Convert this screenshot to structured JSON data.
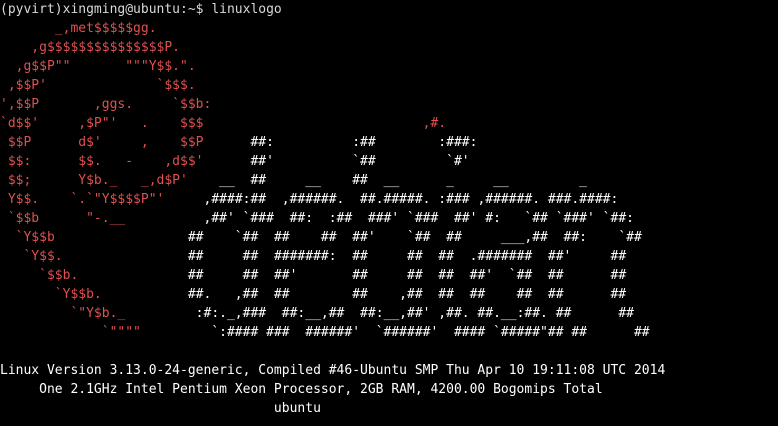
{
  "terminal": {
    "prompt": "(pyvirt)xingming@ubuntu:~$ linuxlogo",
    "logo_lines": [
      {
        "red": "       _,met$$$$$gg.",
        "white": ""
      },
      {
        "red": "    ,g$$$$$$$$$$$$$$$P.",
        "white": ""
      },
      {
        "red": "  ,g$$P\"\"       \"\"\"Y$$.\".",
        "white": ""
      },
      {
        "red": " ,$$P'              `$$$.",
        "white": ""
      },
      {
        "red": "',$$P       ,ggs.     `$$b:",
        "white": ""
      },
      {
        "red": "`d$$'     ,$P\"'   .    $$$",
        "white": "                            ,#."
      },
      {
        "red": " $$P      d$'     ,    $$P",
        "white": "      ##:          :##        :###:"
      },
      {
        "red": " $$:      $$.   -    ,d$$'",
        "white": "      ##'          `##         `#'"
      },
      {
        "red": " $$;      Y$b._   _,d$P'",
        "white": "    __  ##     __    ##  __      _     __         _"
      },
      {
        "red": " Y$$.    `.`\"Y$$$$P\"'",
        "white": "     ,####:##  ,######.  ##.#####. :### ,######. ###.####:"
      },
      {
        "red": " `$$b      \"-.__",
        "white": "          ,##' `###  ##:  :##  ###' `###  ##' #:   `## `###' `##:"
      },
      {
        "red": "  `Y$$b",
        "white": "                 ##    `##  ##    ##  ##'    `##  ##     ___,##  ##:    `##"
      },
      {
        "red": "   `Y$$.",
        "white": "                ##     ##  #######:  ##     ##  ##  .#######  ##'     ##"
      },
      {
        "red": "     `$$b.",
        "white": "              ##     ##  ##'       ##     ##  ##  ##'  `##  ##      ##"
      },
      {
        "red": "       `Y$$b.",
        "white": "           ##.   ,##  ##        ##    ,##  ##  ##    ##  ##      ##"
      },
      {
        "red": "         `\"Y$b._",
        "white": "         :#:._,###  ##:__,##  ##:__,##' ,##. ##.__:##. ##      ##"
      },
      {
        "red": "             `\"\"\"\"",
        "white": "         `:#### ###  ######'  `######'  #### `#####\"## ##      ##"
      }
    ],
    "system_info": {
      "version_line": "Linux Version 3.13.0-24-generic, Compiled #46-Ubuntu SMP Thu Apr 10 19:11:08 UTC 2014",
      "hardware_line": "     One 2.1GHz Intel Pentium Xeon Processor, 2GB RAM, 4200.00 Bogomips Total",
      "hostname_line": "                                   ubuntu"
    },
    "colors": {
      "background": "#000000",
      "logo_swirl": "#e05050",
      "text": "#ffffff"
    }
  }
}
